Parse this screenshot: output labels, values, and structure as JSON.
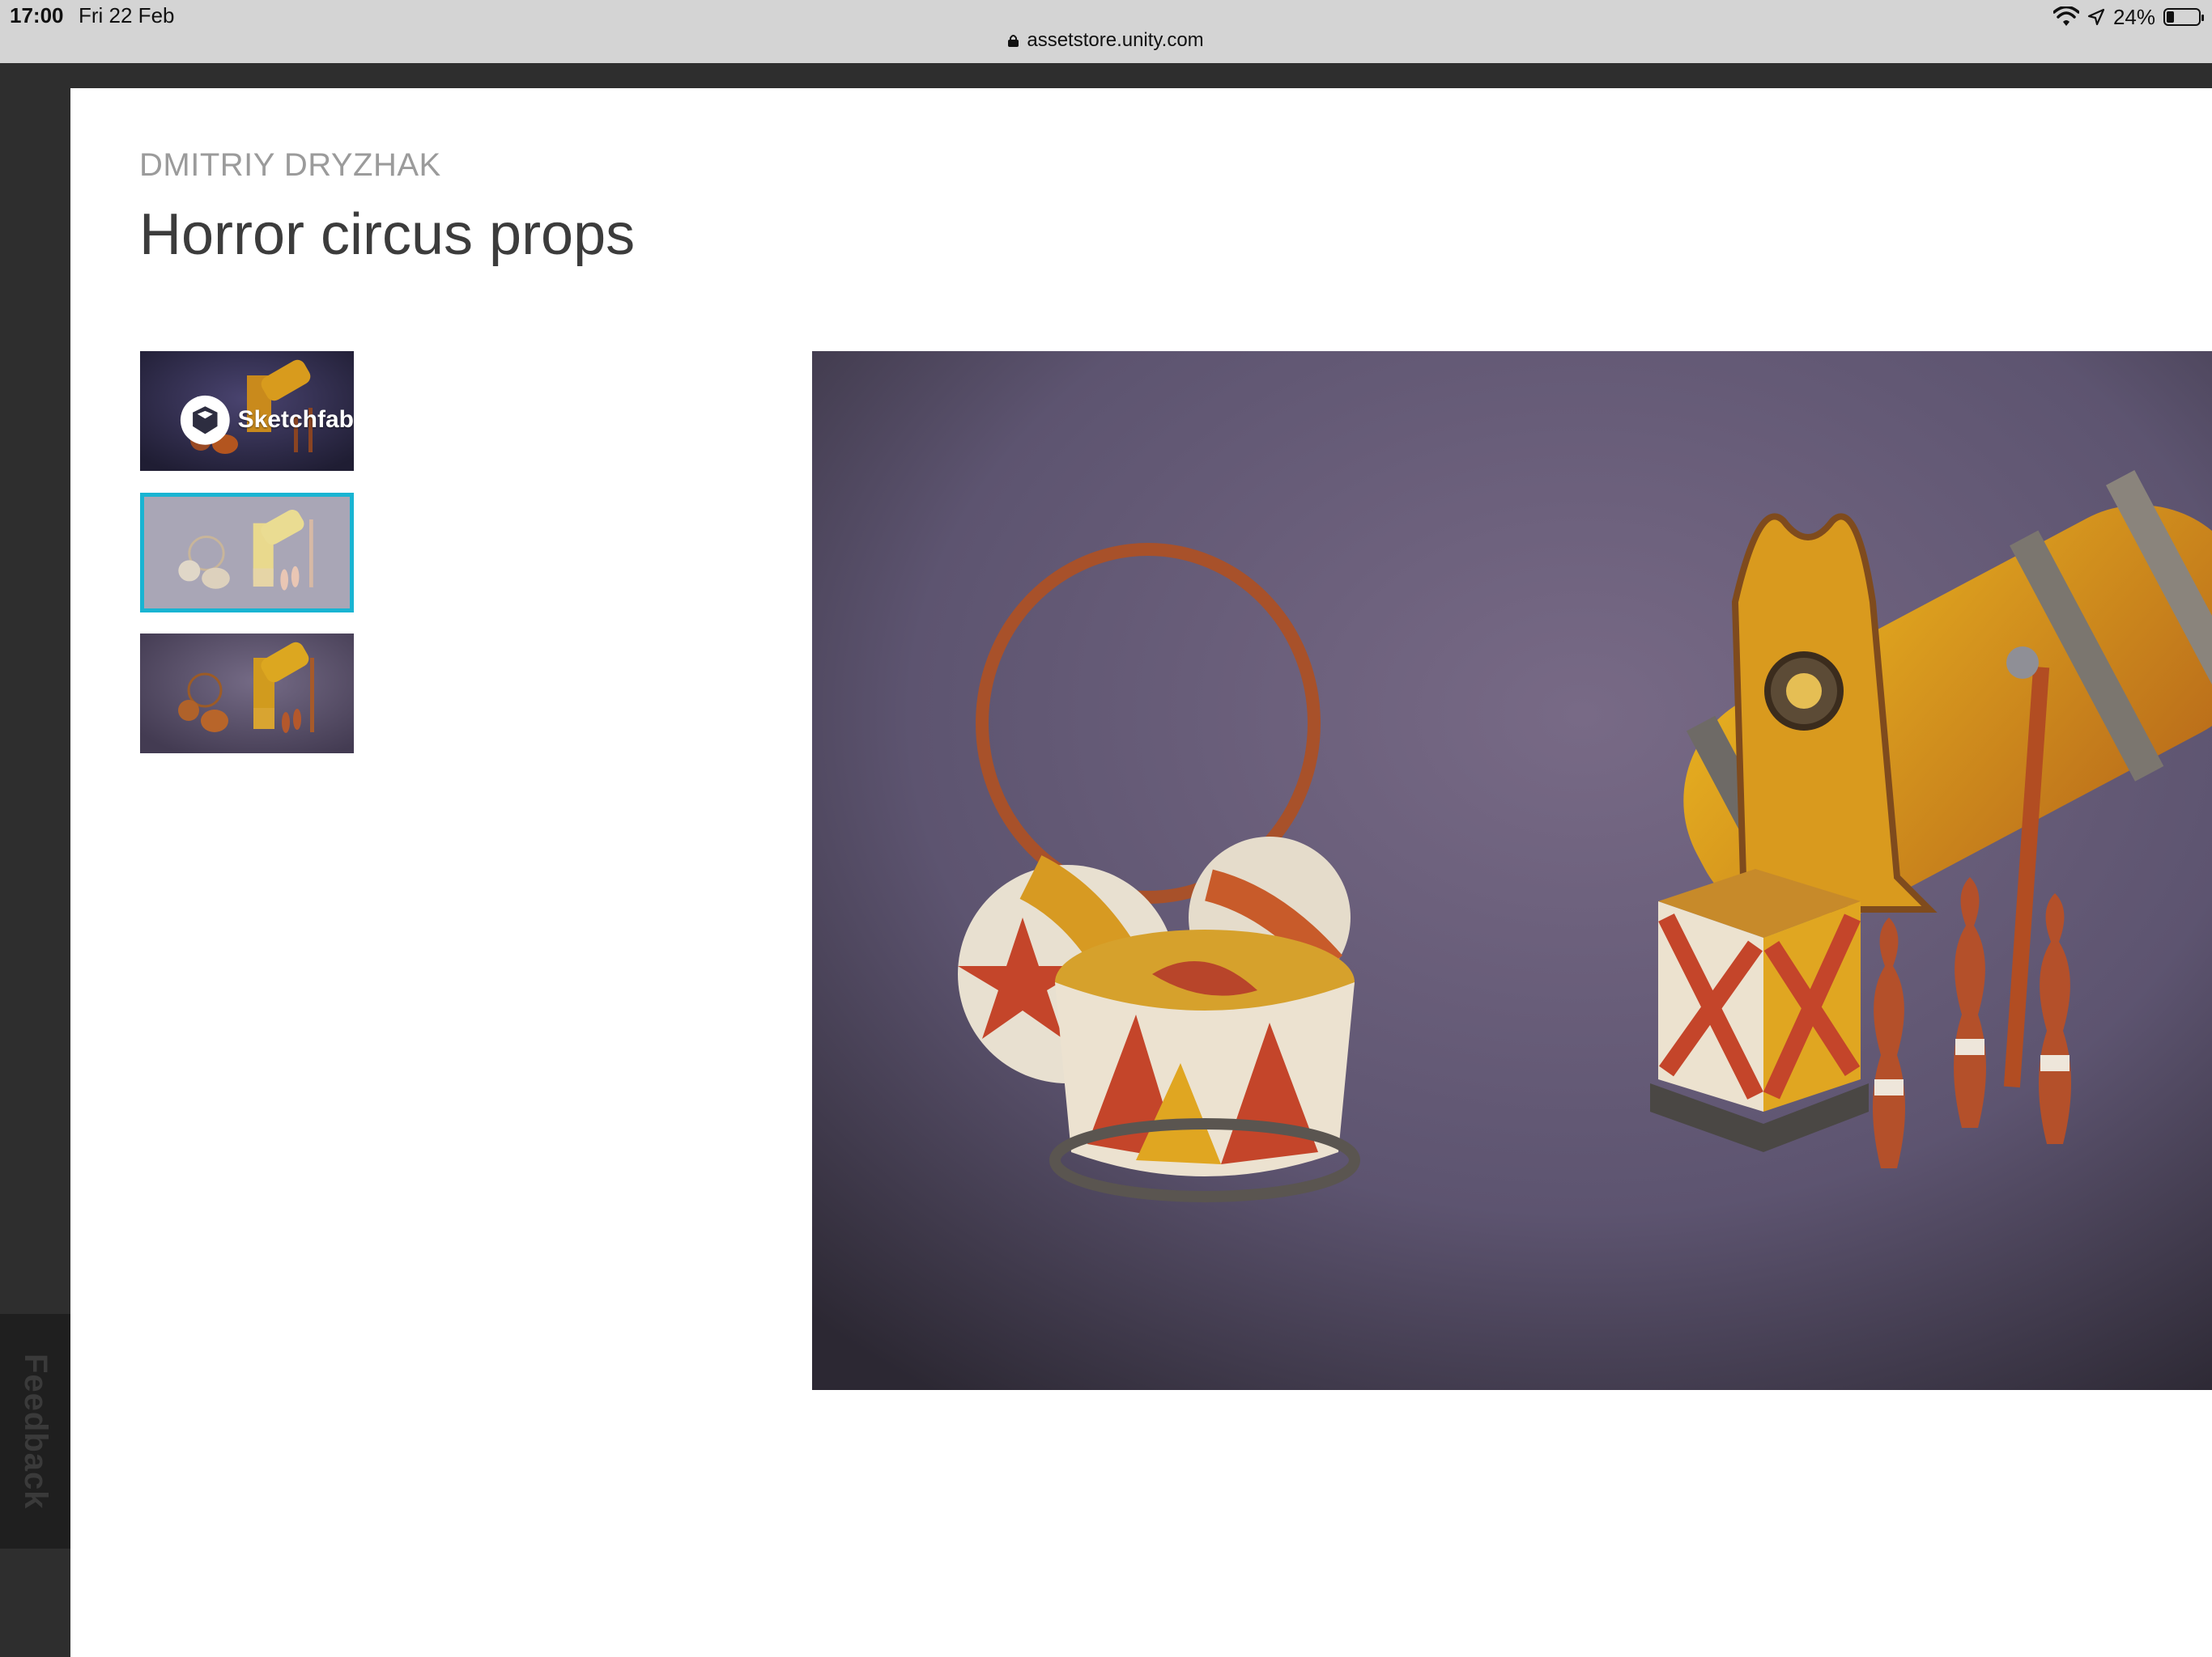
{
  "status_bar": {
    "time": "17:00",
    "date": "Fri 22 Feb",
    "battery": "24%",
    "battery_level": 0.24,
    "url": "assetstore.unity.com"
  },
  "feedback": {
    "label": "Feedback"
  },
  "product": {
    "publisher": "DMITRIY DRYZHAK",
    "title": "Horror circus props"
  },
  "gallery": {
    "thumbnails": [
      {
        "kind": "sketchfab-viewer",
        "badge": "Sketchfab",
        "selected": false
      },
      {
        "kind": "image",
        "selected": true
      },
      {
        "kind": "image",
        "selected": false
      }
    ],
    "selected_index": 1
  },
  "colors": {
    "accent": "#19b4d2",
    "publisher_text": "#9b9b9b",
    "title_text": "#3c3c3c"
  }
}
